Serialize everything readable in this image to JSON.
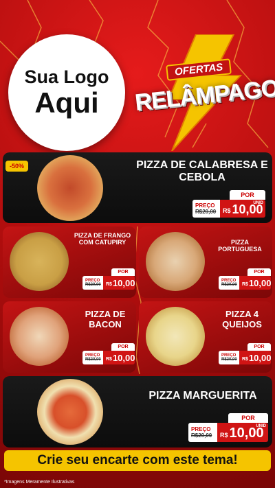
{
  "header": {
    "logo_line1": "Sua Logo",
    "logo_line2": "Aqui",
    "brand_top": "OFERTAS",
    "brand_main": "RELÂMPAGO"
  },
  "products": [
    {
      "name": "PIZZA DE CALABRESA E CEBOLA",
      "badge": "-50%",
      "preco_label": "PREÇO",
      "old_price": "R$20,00",
      "por_label": "POR",
      "currency": "R$",
      "price": "10,00",
      "unit": "UNID"
    },
    {
      "name": "PIZZA DE FRANGO COM CATUPIRY",
      "preco_label": "PREÇO",
      "old_price": "R$20,00",
      "por_label": "POR",
      "currency": "R$",
      "price": "10,00"
    },
    {
      "name": "PIZZA PORTUGUESA",
      "preco_label": "PREÇO",
      "old_price": "R$20,00",
      "por_label": "POR",
      "currency": "R$",
      "price": "10,00"
    },
    {
      "name": "PIZZA DE BACON",
      "preco_label": "PREÇO",
      "old_price": "R$20,00",
      "por_label": "POR",
      "currency": "R$",
      "price": "10,00"
    },
    {
      "name": "PIZZA 4 QUEIJOS",
      "preco_label": "PREÇO",
      "old_price": "R$20,00",
      "por_label": "POR",
      "currency": "R$",
      "price": "10,00"
    },
    {
      "name": "PIZZA MARGUERITA",
      "preco_label": "PREÇO",
      "old_price": "R$20,00",
      "por_label": "POR",
      "currency": "R$",
      "price": "10,00",
      "unit": "UNID"
    }
  ],
  "footer": {
    "cta": "Crie seu encarte com este tema!",
    "disclaimer": "*Imagens Meramente Ilustrativas"
  },
  "colors": {
    "accent_red": "#d01414",
    "accent_yellow": "#f5c400",
    "card_dark": "#111111"
  }
}
